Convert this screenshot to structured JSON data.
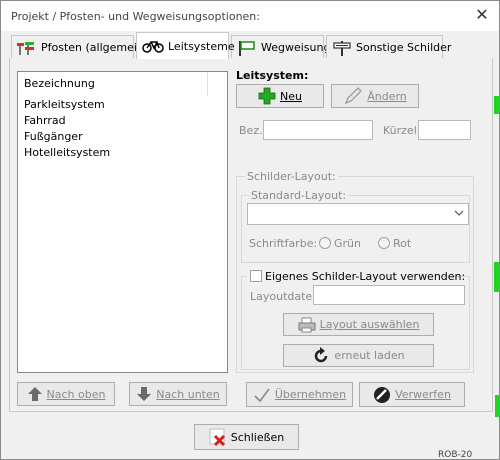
{
  "window": {
    "title": "Projekt / Pfosten- und Wegweisungsoptionen:",
    "close_glyph": "✕"
  },
  "tabs": [
    {
      "label": "Pfosten (allgemein)",
      "icon": "posts-icon",
      "active": false
    },
    {
      "label": "Leitsysteme",
      "icon": "bicycle-icon",
      "active": true
    },
    {
      "label": "Wegweisung",
      "icon": "flag-sign-icon",
      "active": false
    },
    {
      "label": "Sonstige Schilder",
      "icon": "signpost-icon",
      "active": false
    }
  ],
  "list": {
    "header": "Bezeichnung",
    "items": [
      "Parkleitsystem",
      "Fahrrad",
      "Fußgänger",
      "Hotelleitsystem"
    ]
  },
  "list_buttons": {
    "up": "Nach oben",
    "down": "Nach unten"
  },
  "leitsystem": {
    "title": "Leitsystem:",
    "new_label": "Neu",
    "edit_label": "Ändern",
    "bez_label": "Bez.:",
    "bez_value": "",
    "kuerzel_label": "Kürzel:",
    "kuerzel_value": ""
  },
  "layout_group": {
    "title": "Schilder-Layout:",
    "standard_title": "Standard-Layout:",
    "standard_value": "",
    "color_label": "Schriftfarbe:",
    "color_green": "Grün",
    "color_red": "Rot",
    "own_layout_label": "Eigenes Schilder-Layout verwenden:",
    "file_label": "Layoutdatei:",
    "file_value": "",
    "choose_label": "Layout auswählen",
    "reload_label": "erneut laden"
  },
  "actions": {
    "apply": "Übernehmen",
    "discard": "Verwerfen",
    "close": "Schließen"
  },
  "colors": {
    "accent_green": "#1fd41f",
    "close_red": "#d42020",
    "add_green": "#22aa22"
  },
  "background": {
    "bottom_right_text": "ROB-20"
  }
}
